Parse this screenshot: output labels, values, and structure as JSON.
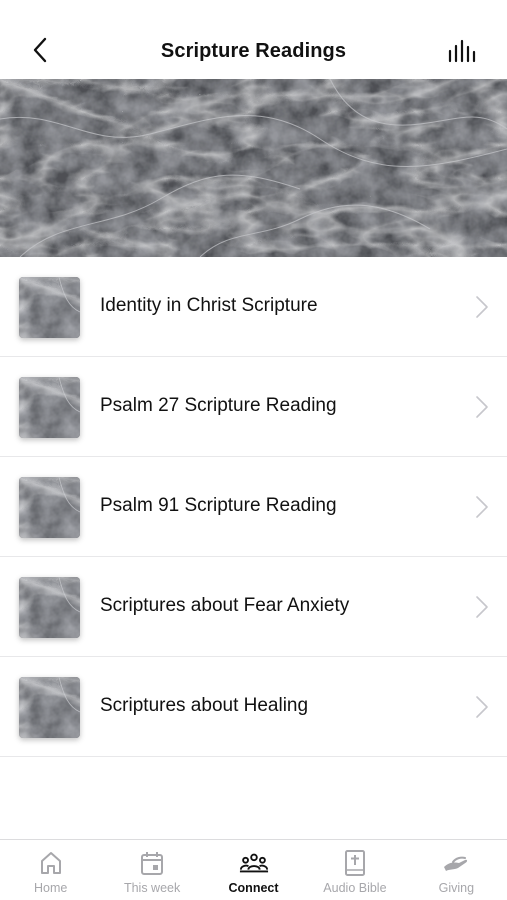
{
  "header": {
    "title": "Scripture Readings",
    "back_icon": "chevron-left-icon",
    "audio_icon": "audio-bars-icon"
  },
  "hero": {
    "image": "gray-marble-texture"
  },
  "items": [
    {
      "label": "Identity in Christ Scripture"
    },
    {
      "label": "Psalm 27 Scripture Reading"
    },
    {
      "label": "Psalm 91 Scripture Reading"
    },
    {
      "label": "Scriptures about Fear Anxiety"
    },
    {
      "label": "Scriptures about Healing"
    }
  ],
  "tabs": [
    {
      "label": "Home",
      "icon": "home-icon",
      "active": false
    },
    {
      "label": "This week",
      "icon": "calendar-icon",
      "active": false
    },
    {
      "label": "Connect",
      "icon": "people-group-icon",
      "active": true
    },
    {
      "label": "Audio Bible",
      "icon": "bible-icon",
      "active": false
    },
    {
      "label": "Giving",
      "icon": "giving-hand-icon",
      "active": false
    }
  ],
  "colors": {
    "text": "#111111",
    "inactive_tab": "#a7a7ab",
    "divider": "#e8e8ea",
    "chevron": "#c7c7cc"
  }
}
